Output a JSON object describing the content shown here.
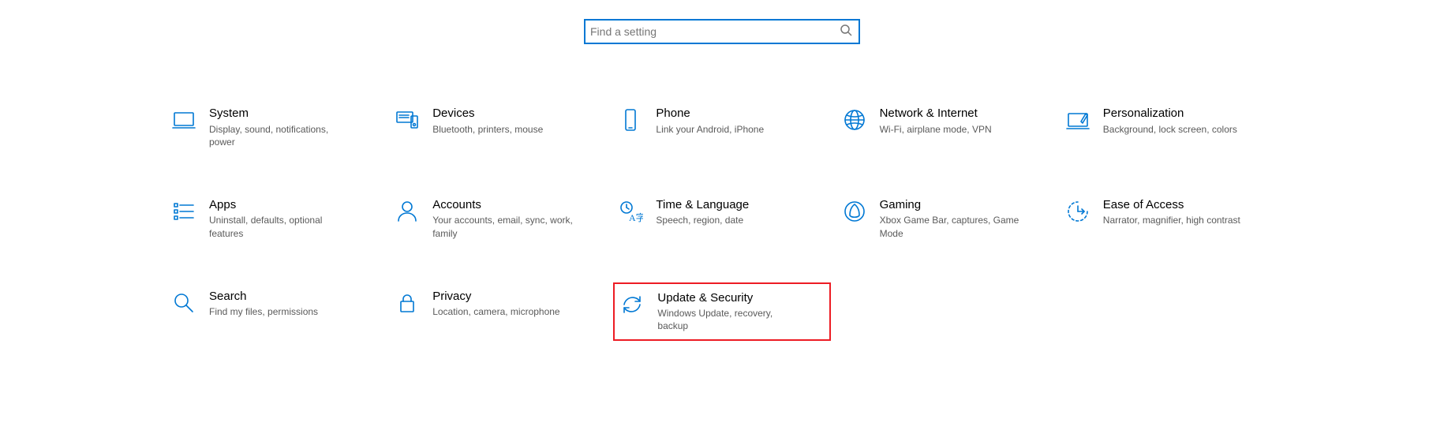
{
  "search": {
    "placeholder": "Find a setting"
  },
  "tiles": [
    {
      "id": "system",
      "title": "System",
      "desc": "Display, sound, notifications, power"
    },
    {
      "id": "devices",
      "title": "Devices",
      "desc": "Bluetooth, printers, mouse"
    },
    {
      "id": "phone",
      "title": "Phone",
      "desc": "Link your Android, iPhone"
    },
    {
      "id": "network",
      "title": "Network & Internet",
      "desc": "Wi-Fi, airplane mode, VPN"
    },
    {
      "id": "personalization",
      "title": "Personalization",
      "desc": "Background, lock screen, colors"
    },
    {
      "id": "apps",
      "title": "Apps",
      "desc": "Uninstall, defaults, optional features"
    },
    {
      "id": "accounts",
      "title": "Accounts",
      "desc": "Your accounts, email, sync, work, family"
    },
    {
      "id": "time",
      "title": "Time & Language",
      "desc": "Speech, region, date"
    },
    {
      "id": "gaming",
      "title": "Gaming",
      "desc": "Xbox Game Bar, captures, Game Mode"
    },
    {
      "id": "ease",
      "title": "Ease of Access",
      "desc": "Narrator, magnifier, high contrast"
    },
    {
      "id": "search-cat",
      "title": "Search",
      "desc": "Find my files, permissions"
    },
    {
      "id": "privacy",
      "title": "Privacy",
      "desc": "Location, camera, microphone"
    },
    {
      "id": "update",
      "title": "Update & Security",
      "desc": "Windows Update, recovery, backup"
    }
  ]
}
